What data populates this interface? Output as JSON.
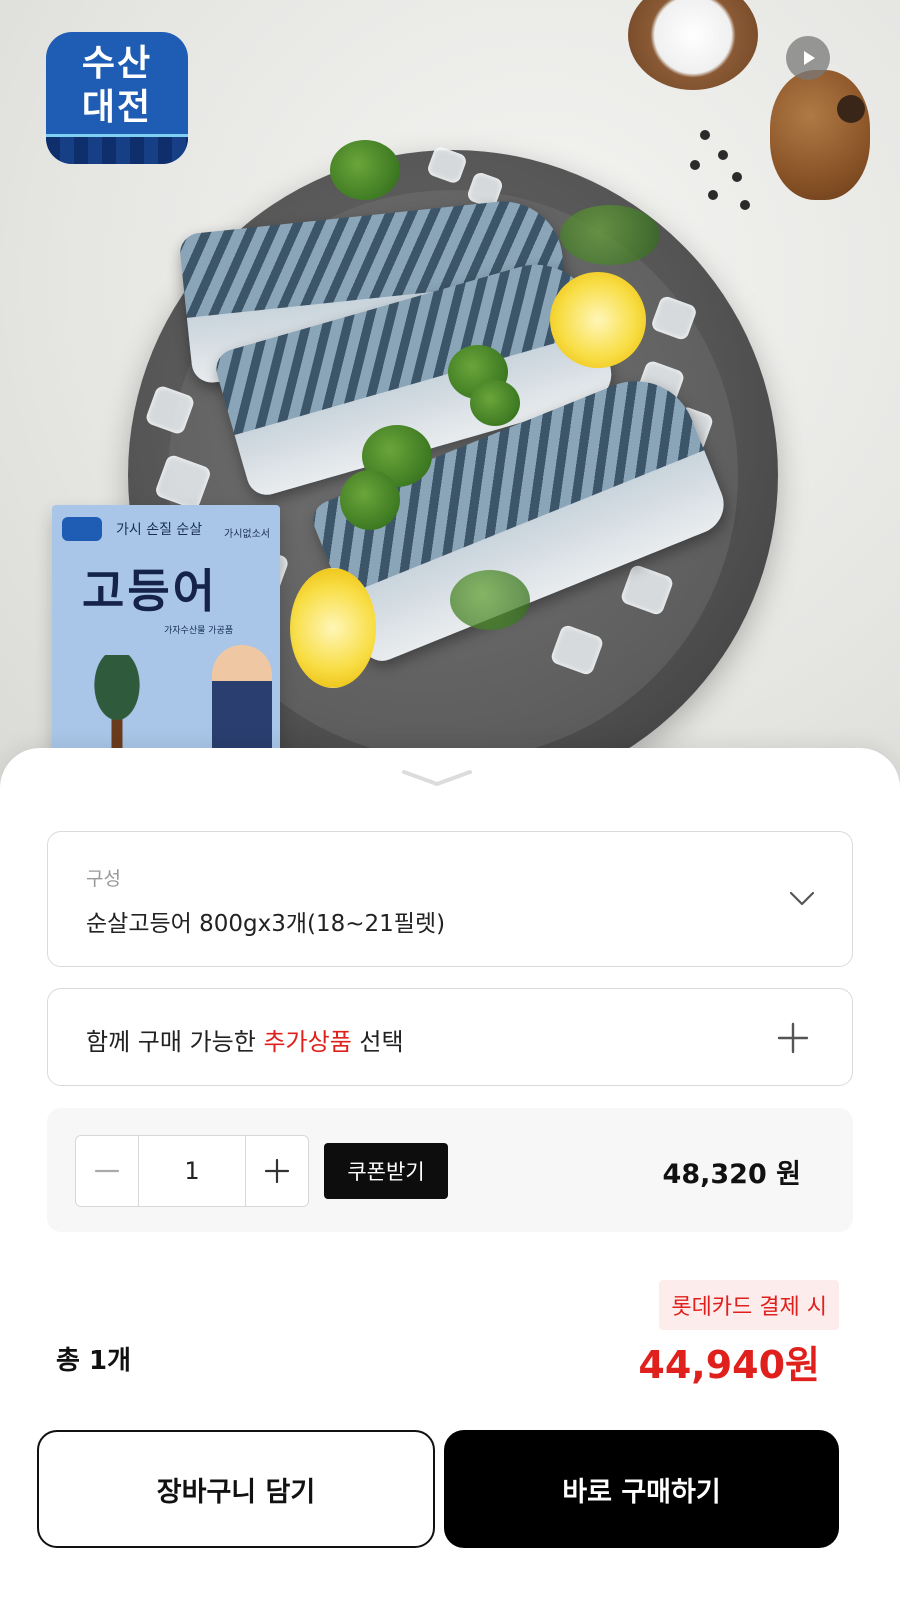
{
  "logo": {
    "line1": "수산",
    "line2": "대전"
  },
  "package": {
    "subtitle": "가시 손질 순살",
    "title": "고등어",
    "corner": "가시없소서",
    "small": "가자수산물 가공품"
  },
  "options": {
    "config_label": "구성",
    "config_value": "순살고등어 800gx3개(18~21필렛)",
    "add_prefix": "함께 구매 가능한 ",
    "add_highlight": "추가상품",
    "add_suffix": " 선택"
  },
  "quantity": {
    "value": "1",
    "coupon_label": "쿠폰받기",
    "line_price": "48,320",
    "currency": "원"
  },
  "summary": {
    "total_count": "총 1개",
    "card_promo": "롯데카드 결제 시",
    "final_price": "44,940원"
  },
  "buttons": {
    "cart": "장바구니 담기",
    "buy": "바로 구매하기"
  },
  "icons": [
    "play-icon",
    "chevron-down-icon",
    "plus-icon",
    "minus-icon",
    "handle-chevron-icon"
  ],
  "colors": {
    "accent_red": "#e0201d",
    "logo_blue": "#1f5db5",
    "primary_black": "#000000"
  }
}
